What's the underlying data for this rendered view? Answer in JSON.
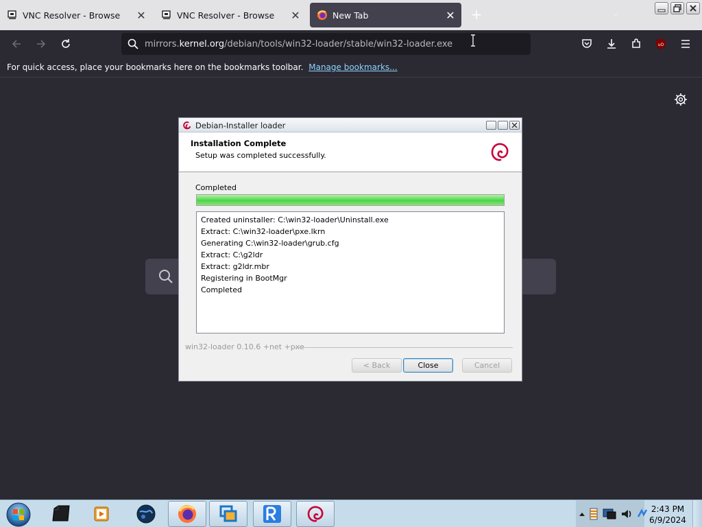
{
  "browser": {
    "tabs": [
      {
        "title": "VNC Resolver - Browse",
        "icon": "vnc-resolver-icon",
        "active": false
      },
      {
        "title": "VNC Resolver - Browse",
        "icon": "vnc-resolver-icon",
        "active": false
      },
      {
        "title": "New Tab",
        "icon": "firefox-icon",
        "active": true
      }
    ],
    "url_prefix": "mirrors.",
    "url_domain": "kernel.org",
    "url_path": "/debian/tools/win32-loader/stable/win32-loader.exe",
    "bookmarks_message": "For quick access, place your bookmarks here on the bookmarks toolbar.",
    "manage_bookmarks_label": "Manage bookmarks..."
  },
  "dialog": {
    "title": "Debian-Installer loader",
    "header_title": "Installation Complete",
    "header_subtitle": "Setup was completed successfully.",
    "status_label": "Completed",
    "progress": 1.0,
    "log": [
      "Created uninstaller: C:\\win32-loader\\Uninstall.exe",
      "Extract: C:\\win32-loader\\pxe.lkrn",
      "Generating C:\\win32-loader\\grub.cfg",
      "Extract: C:\\g2ldr",
      "Extract: g2ldr.mbr",
      "Registering in BootMgr",
      "Completed"
    ],
    "branding": "win32-loader 0.10.6 +net +pxe",
    "buttons": {
      "back": "< Back",
      "close": "Close",
      "cancel": "Cancel"
    }
  },
  "taskbar": {
    "items": [
      "start-orb",
      "terminal-app-icon",
      "media-player-icon",
      "globe-app-icon",
      "firefox-icon",
      "window-manager-icon",
      "vnc-viewer-icon",
      "debian-loader-icon"
    ],
    "clock_time": "2:43 PM",
    "clock_date": "6/9/2024"
  },
  "colors": {
    "browser_bg": "#2b2a33",
    "tabstrip_bg": "#e3e3e6",
    "url_bg": "#1c1b22",
    "link": "#8ed3ff",
    "progress_green": "#4ad64a",
    "debian_red": "#c70036",
    "taskbar_bg": "#c7dcea"
  }
}
